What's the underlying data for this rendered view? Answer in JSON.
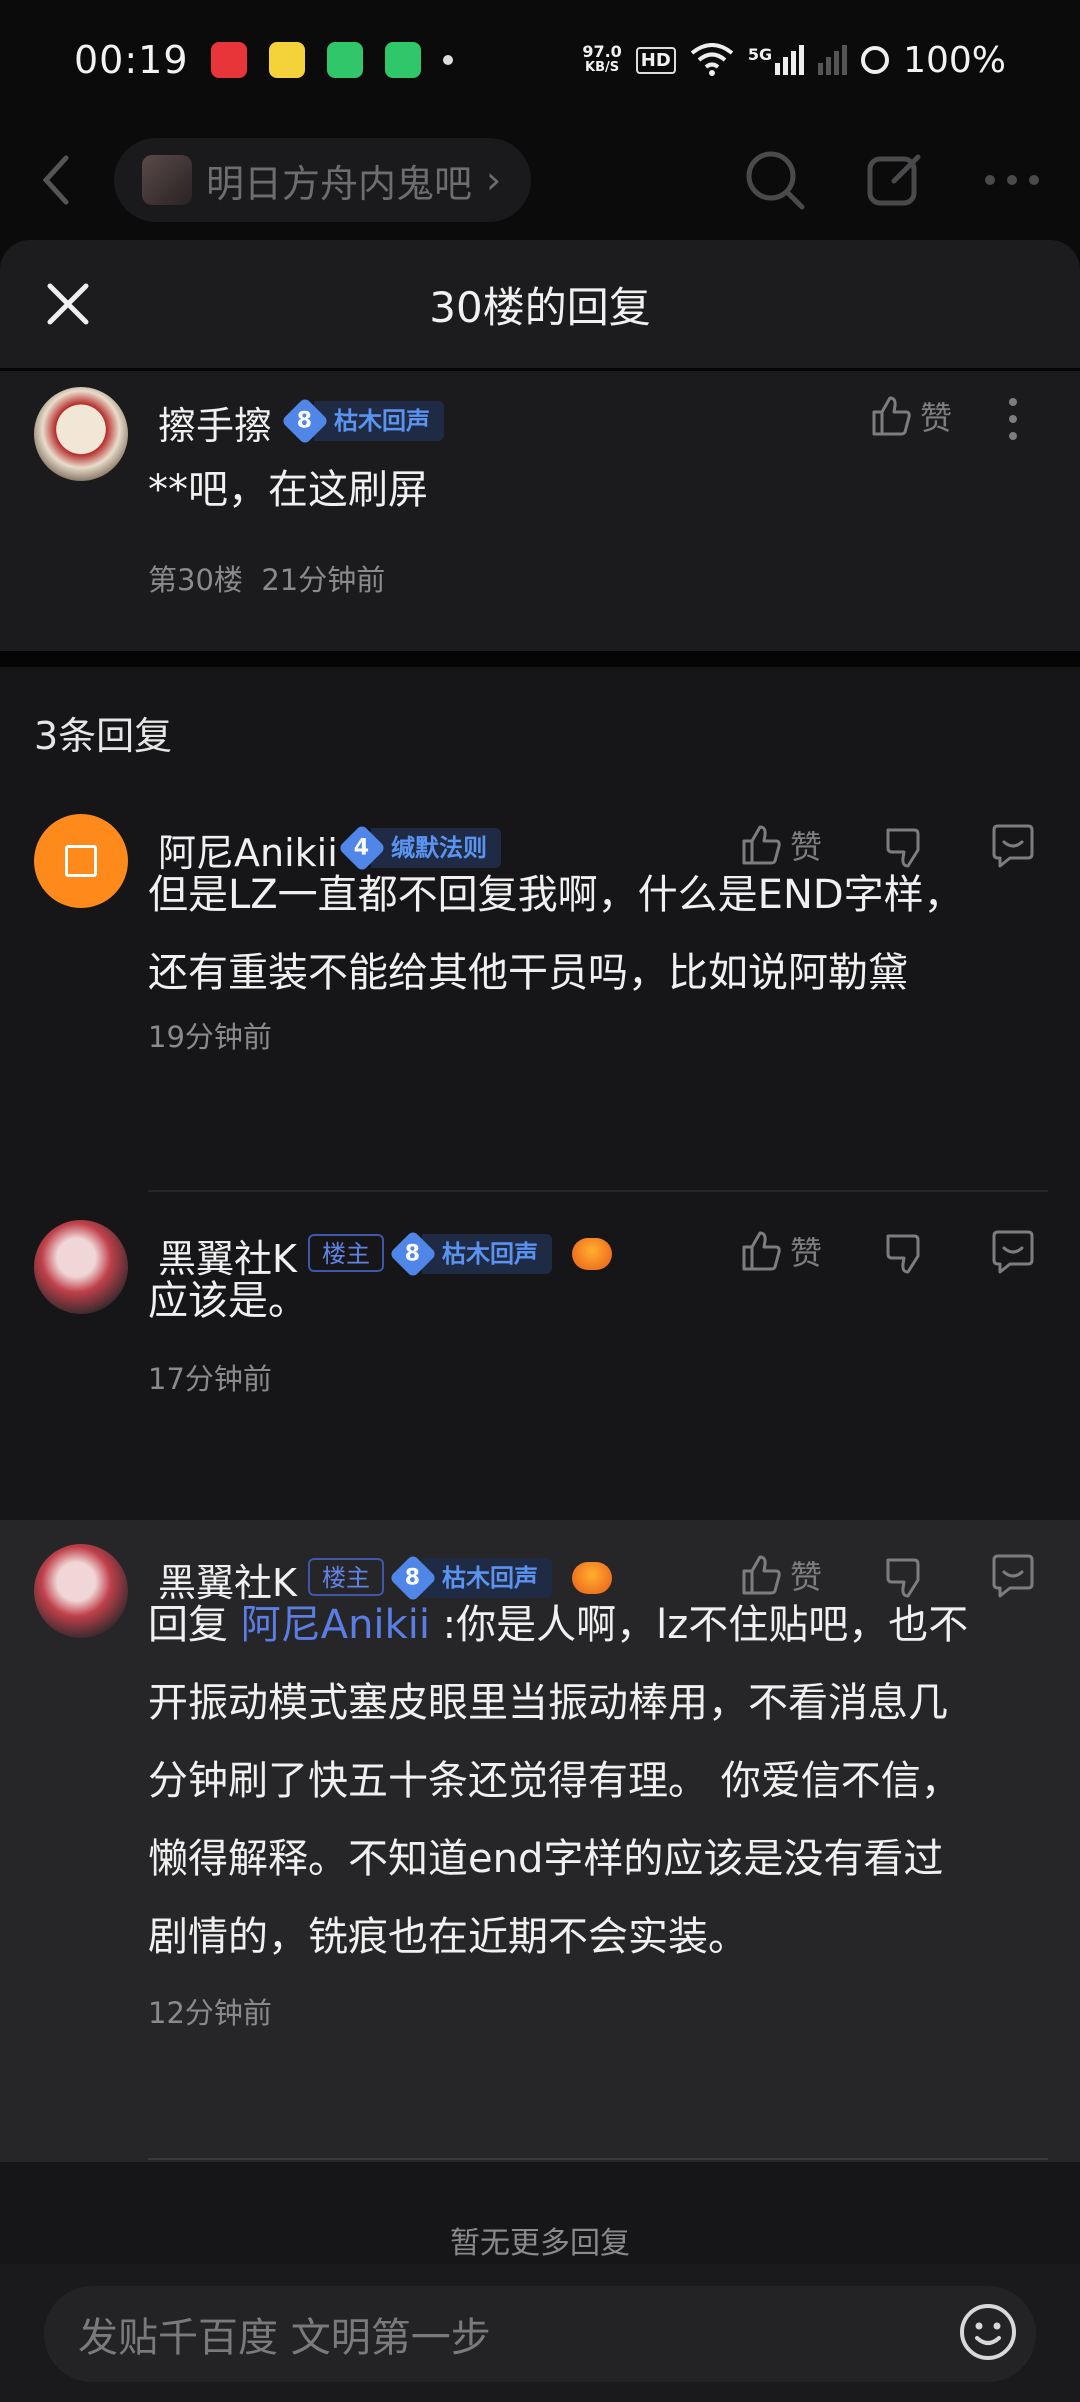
{
  "status_bar": {
    "time": "00:19",
    "net_speed_value": "97.0",
    "net_speed_unit": "KB/S",
    "hd": "HD",
    "signal_5g": "5G",
    "battery": "100%"
  },
  "nav": {
    "forum_name": "明日方舟内鬼吧",
    "forum_chevron": "›"
  },
  "sheet": {
    "title": "30楼的回复"
  },
  "original_post": {
    "username": "擦手擦",
    "level": "8",
    "level_title": "枯木回声",
    "like_label": "赞",
    "content": "**吧，在这刷屏",
    "floor": "第30楼",
    "time": "21分钟前"
  },
  "replies_count": "3条回复",
  "replies": [
    {
      "username": "阿尼Anikii",
      "level": "4",
      "level_title": "缄默法则",
      "like_label": "赞",
      "content_line1": "但是LZ一直都不回复我啊，什么是END字样，",
      "content_line2": "还有重装不能给其他干员吗，比如说阿勒黛",
      "time": "19分钟前"
    },
    {
      "username": "黑翼社K",
      "owner_tag": "楼主",
      "level": "8",
      "level_title": "枯木回声",
      "like_label": "赞",
      "content": "应该是。",
      "time": "17分钟前"
    },
    {
      "username": "黑翼社K",
      "owner_tag": "楼主",
      "level": "8",
      "level_title": "枯木回声",
      "like_label": "赞",
      "reply_prefix": "回复",
      "reply_to": "阿尼Anikii",
      "content_l1_rest": ":你是人啊，lz不住贴吧，也不",
      "content_l2": "开振动模式塞皮眼里当振动棒用，不看消息几",
      "content_l3": "分钟刷了快五十条还觉得有理。 你爱信不信，",
      "content_l4": "懒得解释。不知道end字样的应该是没有看过",
      "content_l5": "剧情的，铣痕也在近期不会实装。",
      "time": "12分钟前"
    }
  ],
  "no_more": "暂无更多回复",
  "compose": {
    "placeholder": "发贴千百度 文明第一步"
  },
  "colors": {
    "background": "#0b0b0c",
    "sheet": "#161618",
    "level_badge": "#4f86e8",
    "mention": "#5a7ee6",
    "owner_tag": "#6283e6"
  }
}
